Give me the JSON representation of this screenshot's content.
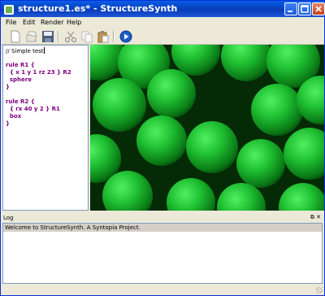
{
  "window": {
    "title": "structure1.es* - StructureSynth",
    "accent": "#0a5de8"
  },
  "menu": [
    "File",
    "Edit",
    "Render",
    "Help"
  ],
  "toolbar": {
    "buttons": [
      "new-icon",
      "open-icon",
      "save-icon",
      "cut-icon",
      "copy-icon",
      "paste-icon",
      "render-icon"
    ]
  },
  "editor": {
    "lines": [
      "// Simple test",
      "",
      "rule R1 {",
      "  { x 1 y 1 rz 23 } R2",
      "  sphere",
      "}",
      "",
      "rule R2 {",
      "  { rx 40 y 2 } R1",
      "  box",
      "}"
    ]
  },
  "viewport": {
    "sphere_color": "#1fbf32"
  },
  "log": {
    "title": "Log",
    "message": "Welcome to StructureSynth. A Syntopia Project."
  }
}
